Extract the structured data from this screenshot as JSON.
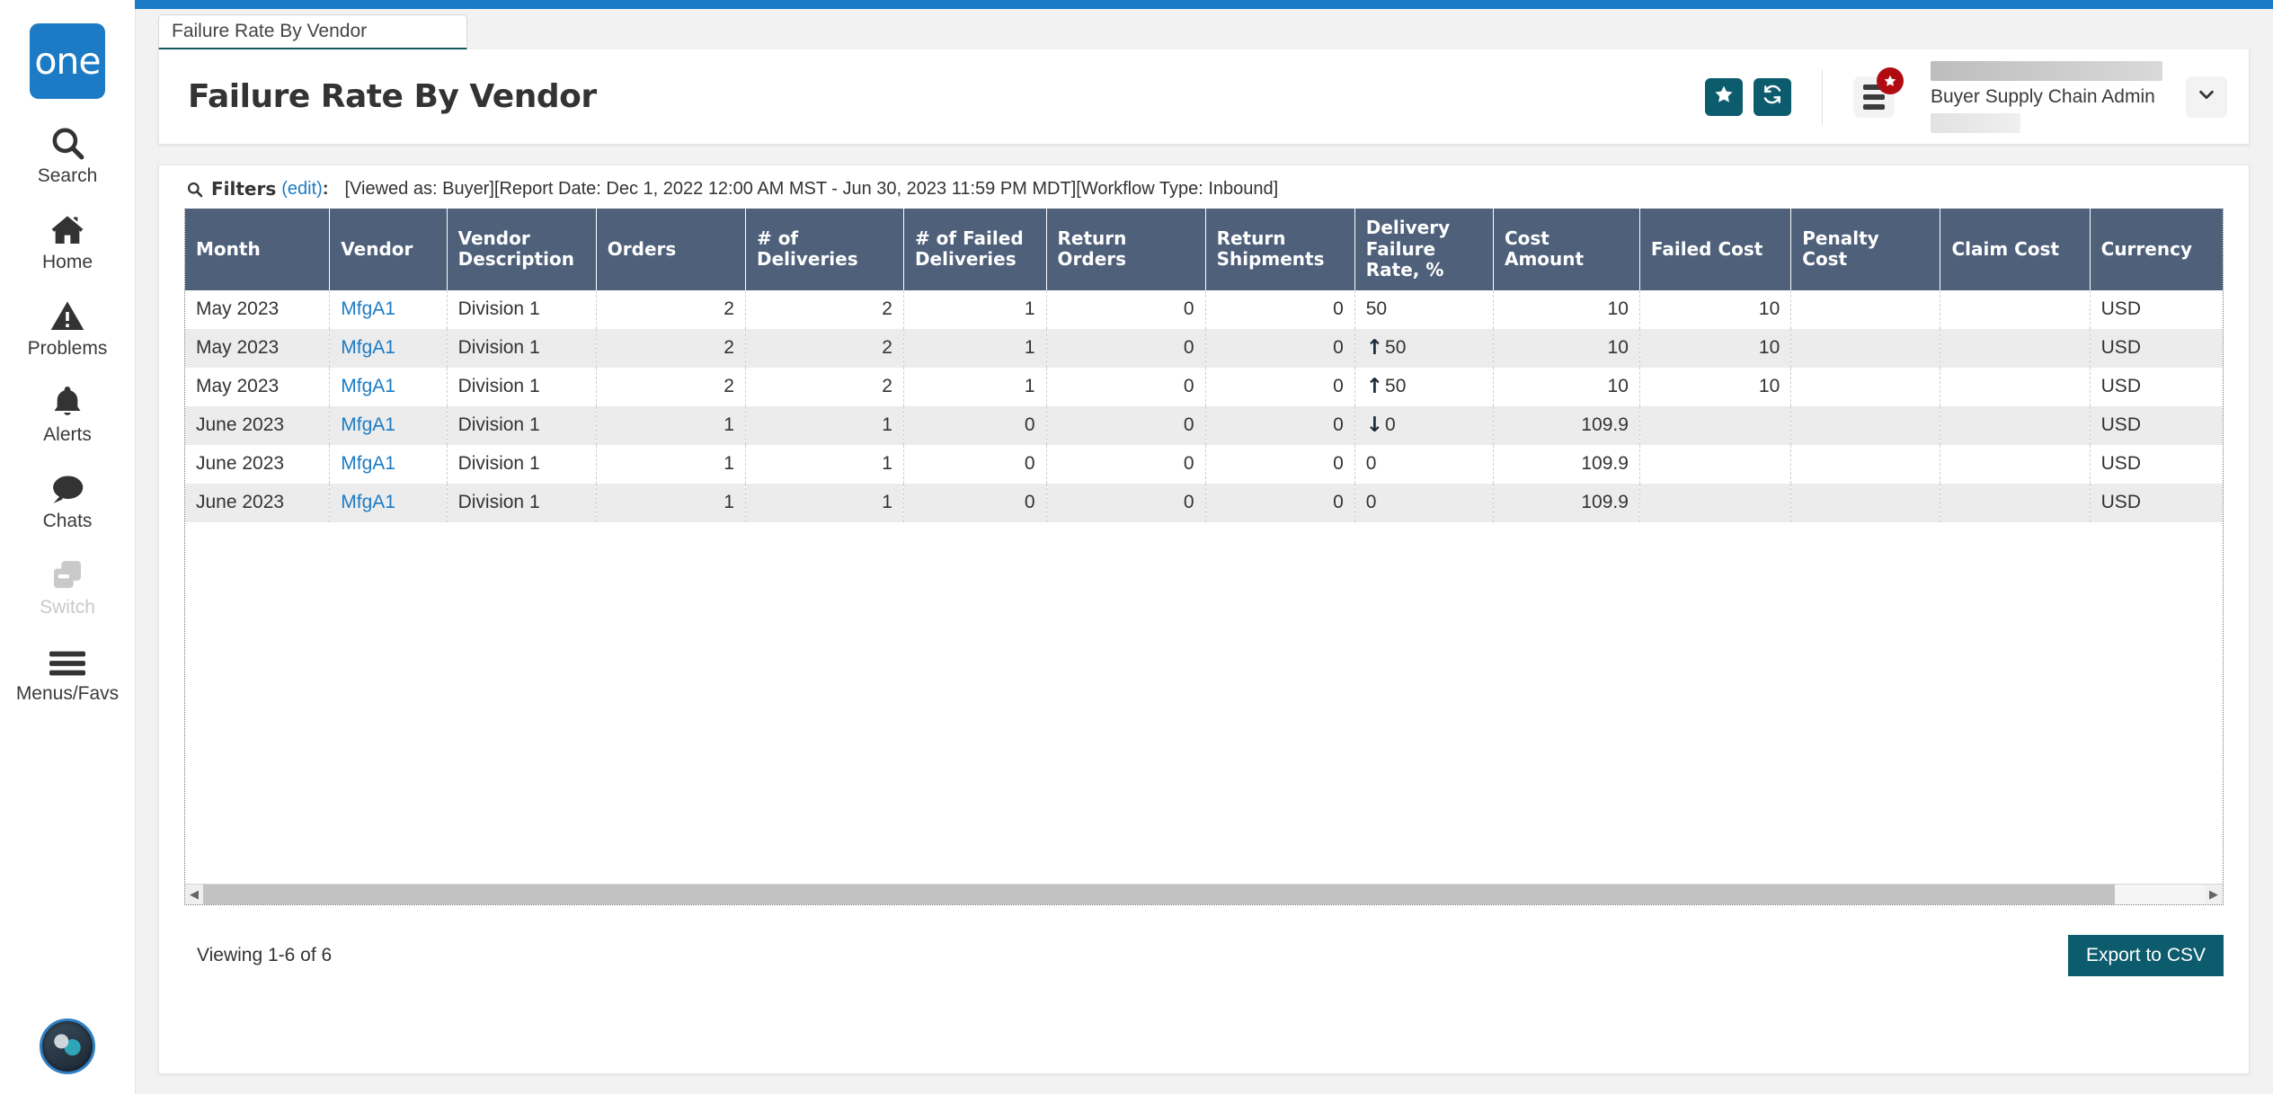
{
  "brand": {
    "logo_text": "one",
    "accent_blue": "#1c7bc4",
    "accent_teal": "#0d5c6e",
    "header_row_bg": "#4e607a",
    "badge_red": "#b00b11"
  },
  "sidebar": {
    "items": [
      {
        "label": "Search",
        "icon": "search-icon",
        "disabled": false
      },
      {
        "label": "Home",
        "icon": "home-icon",
        "disabled": false
      },
      {
        "label": "Problems",
        "icon": "warning-icon",
        "disabled": false
      },
      {
        "label": "Alerts",
        "icon": "bell-icon",
        "disabled": false
      },
      {
        "label": "Chats",
        "icon": "chat-icon",
        "disabled": false
      },
      {
        "label": "Switch",
        "icon": "switch-icon",
        "disabled": true
      },
      {
        "label": "Menus/Favs",
        "icon": "hamburger-icon",
        "disabled": false
      }
    ]
  },
  "tab": {
    "label": "Failure Rate By Vendor"
  },
  "header": {
    "title": "Failure Rate By Vendor",
    "favorite_icon": "star-icon",
    "refresh_icon": "refresh-icon",
    "menu_icon": "list-menu-icon",
    "menu_badge_icon": "star-badge-icon",
    "user_role": "Buyer Supply Chain Admin",
    "caret_icon": "chevron-down-icon"
  },
  "filters": {
    "icon": "magnifier-icon",
    "label": "Filters",
    "edit_label": "(edit)",
    "colon": ":",
    "summary": "[Viewed as: Buyer][Report Date: Dec 1, 2022 12:00 AM MST - Jun 30, 2023 11:59 PM MDT][Workflow Type: Inbound]"
  },
  "table": {
    "columns": [
      {
        "key": "month",
        "label": "Month",
        "align": "left"
      },
      {
        "key": "vendor",
        "label": "Vendor",
        "align": "left"
      },
      {
        "key": "vendor_desc",
        "label": "Vendor Description",
        "align": "left"
      },
      {
        "key": "orders",
        "label": "Orders",
        "align": "right"
      },
      {
        "key": "deliveries",
        "label": "# of Deliveries",
        "align": "right"
      },
      {
        "key": "failed_deliv",
        "label": "# of Failed Deliveries",
        "align": "right"
      },
      {
        "key": "return_ord",
        "label": "Return Orders",
        "align": "right"
      },
      {
        "key": "return_ship",
        "label": "Return Shipments",
        "align": "right"
      },
      {
        "key": "fail_rate",
        "label": "Delivery Failure Rate, %",
        "align": "left"
      },
      {
        "key": "cost_amount",
        "label": "Cost Amount",
        "align": "right"
      },
      {
        "key": "failed_cost",
        "label": "Failed Cost",
        "align": "right"
      },
      {
        "key": "penalty_cost",
        "label": "Penalty Cost",
        "align": "right"
      },
      {
        "key": "claim_cost",
        "label": "Claim Cost",
        "align": "right"
      },
      {
        "key": "currency",
        "label": "Currency",
        "align": "left"
      }
    ],
    "rows": [
      {
        "month": "May 2023",
        "vendor": "MfgA1",
        "vendor_desc": "Division 1",
        "orders": "2",
        "deliveries": "2",
        "failed_deliv": "1",
        "return_ord": "0",
        "return_ship": "0",
        "fail_rate": "50",
        "fail_trend": "",
        "cost_amount": "10",
        "failed_cost": "10",
        "penalty_cost": "",
        "claim_cost": "",
        "currency": "USD"
      },
      {
        "month": "May 2023",
        "vendor": "MfgA1",
        "vendor_desc": "Division 1",
        "orders": "2",
        "deliveries": "2",
        "failed_deliv": "1",
        "return_ord": "0",
        "return_ship": "0",
        "fail_rate": "50",
        "fail_trend": "up",
        "cost_amount": "10",
        "failed_cost": "10",
        "penalty_cost": "",
        "claim_cost": "",
        "currency": "USD"
      },
      {
        "month": "May 2023",
        "vendor": "MfgA1",
        "vendor_desc": "Division 1",
        "orders": "2",
        "deliveries": "2",
        "failed_deliv": "1",
        "return_ord": "0",
        "return_ship": "0",
        "fail_rate": "50",
        "fail_trend": "up",
        "cost_amount": "10",
        "failed_cost": "10",
        "penalty_cost": "",
        "claim_cost": "",
        "currency": "USD"
      },
      {
        "month": "June 2023",
        "vendor": "MfgA1",
        "vendor_desc": "Division 1",
        "orders": "1",
        "deliveries": "1",
        "failed_deliv": "0",
        "return_ord": "0",
        "return_ship": "0",
        "fail_rate": "0",
        "fail_trend": "down",
        "cost_amount": "109.9",
        "failed_cost": "",
        "penalty_cost": "",
        "claim_cost": "",
        "currency": "USD"
      },
      {
        "month": "June 2023",
        "vendor": "MfgA1",
        "vendor_desc": "Division 1",
        "orders": "1",
        "deliveries": "1",
        "failed_deliv": "0",
        "return_ord": "0",
        "return_ship": "0",
        "fail_rate": "0",
        "fail_trend": "",
        "cost_amount": "109.9",
        "failed_cost": "",
        "penalty_cost": "",
        "claim_cost": "",
        "currency": "USD"
      },
      {
        "month": "June 2023",
        "vendor": "MfgA1",
        "vendor_desc": "Division 1",
        "orders": "1",
        "deliveries": "1",
        "failed_deliv": "0",
        "return_ord": "0",
        "return_ship": "0",
        "fail_rate": "0",
        "fail_trend": "",
        "cost_amount": "109.9",
        "failed_cost": "",
        "penalty_cost": "",
        "claim_cost": "",
        "currency": "USD"
      }
    ]
  },
  "scrollbar": {
    "left_arrow": "◀",
    "right_arrow": "▶"
  },
  "footer": {
    "viewing": "Viewing 1-6 of 6",
    "export_label": "Export to CSV"
  }
}
